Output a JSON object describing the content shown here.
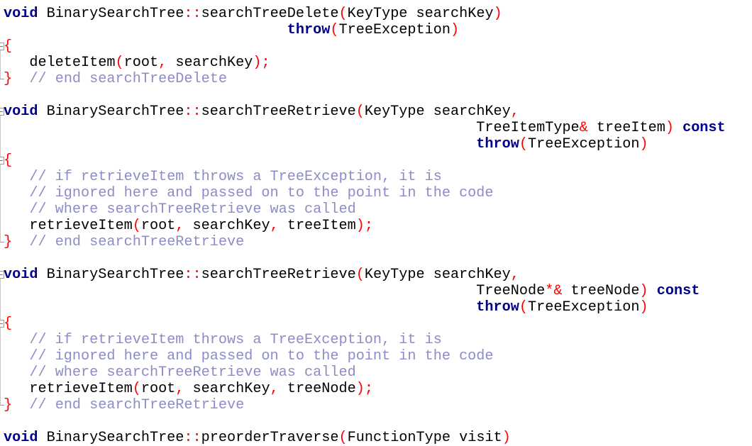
{
  "editor": {
    "language": "C++",
    "colors": {
      "keyword": "#00008b",
      "operator": "#ff0000",
      "comment": "#8c8cc8",
      "identifier": "#000000"
    },
    "lines": [
      {
        "indent": "",
        "tokens": [
          {
            "t": "kw",
            "v": "void"
          },
          {
            "t": "id",
            "v": " BinarySearchTree"
          },
          {
            "t": "op",
            "v": "::"
          },
          {
            "t": "id",
            "v": "searchTreeDelete"
          },
          {
            "t": "op",
            "v": "("
          },
          {
            "t": "id",
            "v": "KeyType searchKey"
          },
          {
            "t": "op",
            "v": ")"
          }
        ]
      },
      {
        "indent": "                                 ",
        "tokens": [
          {
            "t": "kw",
            "v": "throw"
          },
          {
            "t": "op",
            "v": "("
          },
          {
            "t": "id",
            "v": "TreeException"
          },
          {
            "t": "op",
            "v": ")"
          }
        ]
      },
      {
        "indent": "",
        "tokens": [
          {
            "t": "op",
            "v": "{"
          }
        ]
      },
      {
        "indent": "   ",
        "tokens": [
          {
            "t": "id",
            "v": "deleteItem"
          },
          {
            "t": "op",
            "v": "("
          },
          {
            "t": "id",
            "v": "root"
          },
          {
            "t": "op",
            "v": ","
          },
          {
            "t": "id",
            "v": " searchKey"
          },
          {
            "t": "op",
            "v": ");"
          }
        ]
      },
      {
        "indent": "",
        "tokens": [
          {
            "t": "op",
            "v": "}"
          },
          {
            "t": "id",
            "v": "  "
          },
          {
            "t": "cm",
            "v": "// end searchTreeDelete"
          }
        ]
      },
      {
        "indent": "",
        "tokens": []
      },
      {
        "indent": "",
        "tokens": [
          {
            "t": "kw",
            "v": "void"
          },
          {
            "t": "id",
            "v": " BinarySearchTree"
          },
          {
            "t": "op",
            "v": "::"
          },
          {
            "t": "id",
            "v": "searchTreeRetrieve"
          },
          {
            "t": "op",
            "v": "("
          },
          {
            "t": "id",
            "v": "KeyType searchKey"
          },
          {
            "t": "op",
            "v": ","
          }
        ]
      },
      {
        "indent": "                                                       ",
        "tokens": [
          {
            "t": "id",
            "v": "TreeItemType"
          },
          {
            "t": "op",
            "v": "&"
          },
          {
            "t": "id",
            "v": " treeItem"
          },
          {
            "t": "op",
            "v": ")"
          },
          {
            "t": "id",
            "v": " "
          },
          {
            "t": "kw",
            "v": "const"
          }
        ]
      },
      {
        "indent": "                                                       ",
        "tokens": [
          {
            "t": "kw",
            "v": "throw"
          },
          {
            "t": "op",
            "v": "("
          },
          {
            "t": "id",
            "v": "TreeException"
          },
          {
            "t": "op",
            "v": ")"
          }
        ]
      },
      {
        "indent": "",
        "tokens": [
          {
            "t": "op",
            "v": "{"
          }
        ]
      },
      {
        "indent": "   ",
        "tokens": [
          {
            "t": "cm",
            "v": "// if retrieveItem throws a TreeException, it is"
          }
        ]
      },
      {
        "indent": "   ",
        "tokens": [
          {
            "t": "cm",
            "v": "// ignored here and passed on to the point in the code"
          }
        ]
      },
      {
        "indent": "   ",
        "tokens": [
          {
            "t": "cm",
            "v": "// where searchTreeRetrieve was called"
          }
        ]
      },
      {
        "indent": "   ",
        "tokens": [
          {
            "t": "id",
            "v": "retrieveItem"
          },
          {
            "t": "op",
            "v": "("
          },
          {
            "t": "id",
            "v": "root"
          },
          {
            "t": "op",
            "v": ","
          },
          {
            "t": "id",
            "v": " searchKey"
          },
          {
            "t": "op",
            "v": ","
          },
          {
            "t": "id",
            "v": " treeItem"
          },
          {
            "t": "op",
            "v": ");"
          }
        ]
      },
      {
        "indent": "",
        "tokens": [
          {
            "t": "op",
            "v": "}"
          },
          {
            "t": "id",
            "v": "  "
          },
          {
            "t": "cm",
            "v": "// end searchTreeRetrieve"
          }
        ]
      },
      {
        "indent": "",
        "tokens": []
      },
      {
        "indent": "",
        "tokens": [
          {
            "t": "kw",
            "v": "void"
          },
          {
            "t": "id",
            "v": " BinarySearchTree"
          },
          {
            "t": "op",
            "v": "::"
          },
          {
            "t": "id",
            "v": "searchTreeRetrieve"
          },
          {
            "t": "op",
            "v": "("
          },
          {
            "t": "id",
            "v": "KeyType searchKey"
          },
          {
            "t": "op",
            "v": ","
          }
        ]
      },
      {
        "indent": "                                                       ",
        "tokens": [
          {
            "t": "id",
            "v": "TreeNode"
          },
          {
            "t": "op",
            "v": "*&"
          },
          {
            "t": "id",
            "v": " treeNode"
          },
          {
            "t": "op",
            "v": ")"
          },
          {
            "t": "id",
            "v": " "
          },
          {
            "t": "kw",
            "v": "const"
          }
        ]
      },
      {
        "indent": "                                                       ",
        "tokens": [
          {
            "t": "kw",
            "v": "throw"
          },
          {
            "t": "op",
            "v": "("
          },
          {
            "t": "id",
            "v": "TreeException"
          },
          {
            "t": "op",
            "v": ")"
          }
        ]
      },
      {
        "indent": "",
        "tokens": [
          {
            "t": "op",
            "v": "{"
          }
        ]
      },
      {
        "indent": "   ",
        "tokens": [
          {
            "t": "cm",
            "v": "// if retrieveItem throws a TreeException, it is"
          }
        ]
      },
      {
        "indent": "   ",
        "tokens": [
          {
            "t": "cm",
            "v": "// ignored here and passed on to the point in the code"
          }
        ]
      },
      {
        "indent": "   ",
        "tokens": [
          {
            "t": "cm",
            "v": "// where searchTreeRetrieve was called"
          }
        ]
      },
      {
        "indent": "   ",
        "tokens": [
          {
            "t": "id",
            "v": "retrieveItem"
          },
          {
            "t": "op",
            "v": "("
          },
          {
            "t": "id",
            "v": "root"
          },
          {
            "t": "op",
            "v": ","
          },
          {
            "t": "id",
            "v": " searchKey"
          },
          {
            "t": "op",
            "v": ","
          },
          {
            "t": "id",
            "v": " treeNode"
          },
          {
            "t": "op",
            "v": ");"
          }
        ]
      },
      {
        "indent": "",
        "tokens": [
          {
            "t": "op",
            "v": "}"
          },
          {
            "t": "id",
            "v": "  "
          },
          {
            "t": "cm",
            "v": "// end searchTreeRetrieve"
          }
        ]
      },
      {
        "indent": "",
        "tokens": []
      },
      {
        "indent": "",
        "tokens": [
          {
            "t": "kw",
            "v": "void"
          },
          {
            "t": "id",
            "v": " BinarySearchTree"
          },
          {
            "t": "op",
            "v": "::"
          },
          {
            "t": "id",
            "v": "preorderTraverse"
          },
          {
            "t": "op",
            "v": "("
          },
          {
            "t": "id",
            "v": "FunctionType visit"
          },
          {
            "t": "op",
            "v": ")"
          }
        ]
      }
    ],
    "fold_markers": [
      {
        "line": 2,
        "kind": "box"
      },
      {
        "line": 4,
        "kind": "end"
      },
      {
        "line": 6,
        "kind": "box"
      },
      {
        "line": 9,
        "kind": "box"
      },
      {
        "line": 14,
        "kind": "end"
      },
      {
        "line": 16,
        "kind": "box"
      },
      {
        "line": 19,
        "kind": "box"
      },
      {
        "line": 24,
        "kind": "end"
      }
    ]
  }
}
